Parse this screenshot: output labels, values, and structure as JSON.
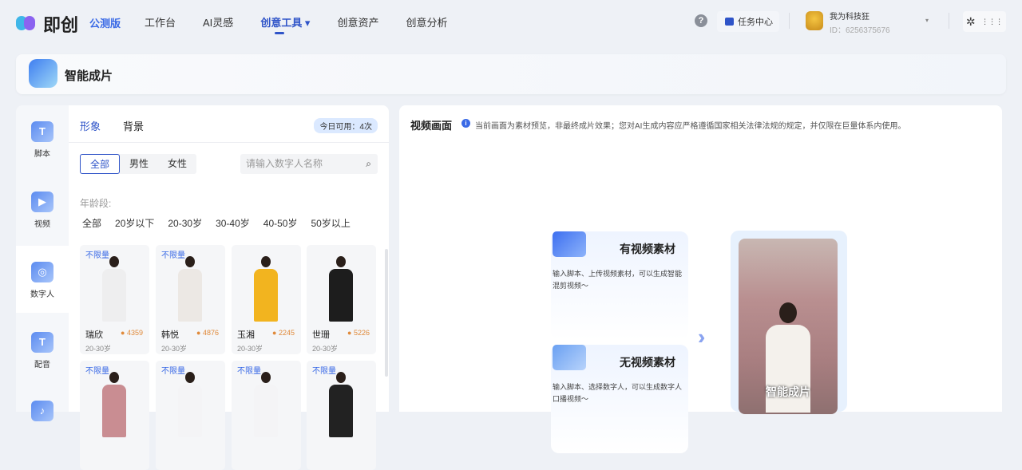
{
  "brand": {
    "name": "即创",
    "edition": "公测版"
  },
  "nav": [
    "工作台",
    "AI灵感",
    "创意工具 ▾",
    "创意资产",
    "创意分析"
  ],
  "top": {
    "help": "?",
    "task_center": "任务中心",
    "user_name": "我为科技狂",
    "user_id": "ID：6256375676",
    "caret": "▾",
    "settings": "✲",
    "apps": "⋮⋮⋮"
  },
  "header": {
    "title": "智能成片"
  },
  "sidebar": [
    {
      "label": "脚本",
      "glyph": "T"
    },
    {
      "label": "视频",
      "glyph": "▶"
    },
    {
      "label": "数字人",
      "glyph": "◎"
    },
    {
      "label": "配音",
      "glyph": "T"
    },
    {
      "label": "",
      "glyph": "♪"
    }
  ],
  "panel": {
    "tabs": [
      "形象",
      "背景"
    ],
    "quota": "今日可用：4次",
    "genders": [
      "全部",
      "男性",
      "女性"
    ],
    "search_placeholder": "请输入数字人名称",
    "search_icon": "⌕",
    "age_label": "年龄段:",
    "ages": [
      "全部",
      "20岁以下",
      "20-30岁",
      "30-40岁",
      "40-50岁",
      "50岁以上"
    ],
    "cards": [
      {
        "tag": "不限量",
        "name": "瑞欣",
        "score": "● 4359",
        "age": "20-30岁",
        "color": "#eeeeef"
      },
      {
        "tag": "不限量",
        "name": "韩悦",
        "score": "● 4876",
        "age": "20-30岁",
        "color": "#ece8e4"
      },
      {
        "tag": "",
        "name": "玉湘",
        "score": "● 2245",
        "age": "20-30岁",
        "color": "#f2b41f"
      },
      {
        "tag": "",
        "name": "世珊",
        "score": "● 5226",
        "age": "20-30岁",
        "color": "#1d1d1d"
      },
      {
        "tag": "不限量",
        "name": "",
        "score": "",
        "age": "",
        "color": "#c98d92"
      },
      {
        "tag": "不限量",
        "name": "",
        "score": "",
        "age": "",
        "color": "#f4f4f6"
      },
      {
        "tag": "不限量",
        "name": "",
        "score": "",
        "age": "",
        "color": "#f4f4f6"
      },
      {
        "tag": "不限量",
        "name": "",
        "score": "",
        "age": "",
        "color": "#222"
      }
    ]
  },
  "preview": {
    "title": "视频画面",
    "info": "i",
    "note": "当前画面为素材预览，非最终成片效果；您对AI生成内容应严格遵循国家相关法律法规的规定，并仅限在巨量体系内使用。",
    "options": [
      {
        "title": "有视频素材",
        "desc": "输入脚本、上传视频素材，可以生成智能混剪视频～"
      },
      {
        "title": "无视频素材",
        "desc": "输入脚本、选择数字人，可以生成数字人口播视频～"
      }
    ],
    "arrow": "››",
    "caption": "智能成片"
  },
  "colors": {
    "accent": "#2f54c8"
  }
}
